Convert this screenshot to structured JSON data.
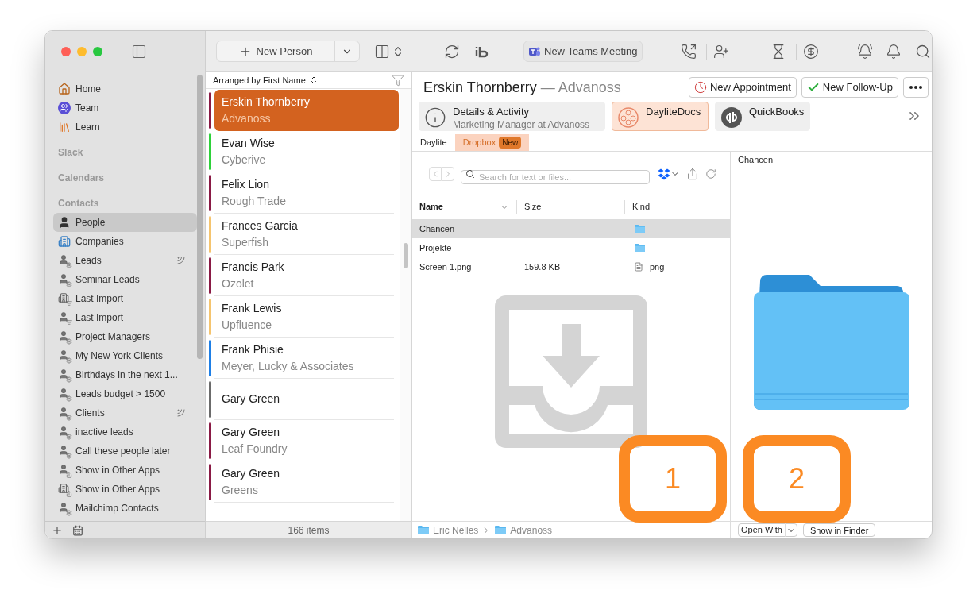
{
  "toolbar": {
    "new_person": "New Person",
    "teams_button": "New Teams Meeting"
  },
  "sidebar": {
    "top_items": [
      {
        "label": "Home",
        "kind": "home",
        "selected": false
      },
      {
        "label": "Team",
        "kind": "team",
        "selected": false
      },
      {
        "label": "Learn",
        "kind": "learn",
        "selected": false
      }
    ],
    "sections": [
      {
        "title": "Slack"
      },
      {
        "title": "Calendars"
      },
      {
        "title": "Contacts",
        "items": [
          {
            "label": "People",
            "kind": "person",
            "selected": true,
            "synced": false
          },
          {
            "label": "Companies",
            "kind": "company",
            "selected": false,
            "synced": false
          },
          {
            "label": "Leads",
            "kind": "smart",
            "selected": false,
            "synced": true
          },
          {
            "label": "Seminar Leads",
            "kind": "smart",
            "selected": false,
            "synced": false
          },
          {
            "label": "Last Import",
            "kind": "company-list",
            "selected": false,
            "synced": false
          },
          {
            "label": "Last Import",
            "kind": "person-list",
            "selected": false,
            "synced": false
          },
          {
            "label": "Project Managers",
            "kind": "smart",
            "selected": false,
            "synced": false
          },
          {
            "label": "My New York Clients",
            "kind": "smart",
            "selected": false,
            "synced": false
          },
          {
            "label": "Birthdays in the next 1...",
            "kind": "smart",
            "selected": false,
            "synced": false
          },
          {
            "label": "Leads budget > 1500",
            "kind": "smart",
            "selected": false,
            "synced": false
          },
          {
            "label": "Clients",
            "kind": "smart",
            "selected": false,
            "synced": true
          },
          {
            "label": "inactive leads",
            "kind": "smart",
            "selected": false,
            "synced": false
          },
          {
            "label": "Call these people later",
            "kind": "smart",
            "selected": false,
            "synced": false
          },
          {
            "label": "Show in Other Apps",
            "kind": "person-share",
            "selected": false,
            "synced": false
          },
          {
            "label": "Show in Other Apps",
            "kind": "company-share",
            "selected": false,
            "synced": false
          },
          {
            "label": "Mailchimp Contacts",
            "kind": "smart",
            "selected": false,
            "synced": false
          }
        ]
      }
    ]
  },
  "list": {
    "sort_label": "Arranged by First Name",
    "count": "166 items",
    "rows": [
      {
        "name": "Erskin Thornberry",
        "company": "Advanoss",
        "color": "#8a1a45",
        "selected": true
      },
      {
        "name": "Evan Wise",
        "company": "Cyberive",
        "color": "#2ed13a",
        "selected": false
      },
      {
        "name": "Felix Lion",
        "company": "Rough Trade",
        "color": "#8a1a45",
        "selected": false
      },
      {
        "name": "Frances Garcia",
        "company": "Superfish",
        "color": "#f5c46e",
        "selected": false
      },
      {
        "name": "Francis Park",
        "company": "Ozolet",
        "color": "#8a1a45",
        "selected": false
      },
      {
        "name": "Frank Lewis",
        "company": "Upfluence",
        "color": "#f5c46e",
        "selected": false
      },
      {
        "name": "Frank Phisie",
        "company": "Meyer, Lucky & Associates",
        "color": "#1e7fe6",
        "selected": false
      },
      {
        "name": "Gary Green",
        "color": "#6b6b6b",
        "selected": false
      },
      {
        "name": "Gary Green",
        "company": "Leaf Foundry",
        "color": "#8a1a45",
        "selected": false
      },
      {
        "name": "Gary Green",
        "company": "Greens",
        "color": "#8a1a45",
        "selected": false
      }
    ]
  },
  "detail": {
    "name": "Erskin Thornberry",
    "company": "— Advanoss",
    "buttons": [
      {
        "label": "New Appointment",
        "kind": "appointment"
      },
      {
        "label": "New Follow-Up",
        "kind": "followup"
      }
    ],
    "tabs": [
      {
        "title": "Details & Activity",
        "subtitle": "Marketing Manager at Advanoss",
        "kind": "info",
        "selected": false
      },
      {
        "title": "DayliteDocs",
        "kind": "docs",
        "selected": true
      },
      {
        "title": "QuickBooks",
        "kind": "qb",
        "selected": false
      }
    ],
    "subtabs": [
      {
        "label": "Daylite",
        "selected": false
      },
      {
        "label": "Dropbox",
        "badge": "New",
        "selected": true
      }
    ]
  },
  "file_browser": {
    "search_placeholder": "Search for text or files...",
    "columns": [
      "Name",
      "Size",
      "Kind"
    ],
    "rows": [
      {
        "name": "Chancen",
        "kind": "folder",
        "selected": true
      },
      {
        "name": "Projekte",
        "kind": "folder",
        "selected": false
      },
      {
        "name": "Screen 1.png",
        "size": "159.8 KB",
        "kind_label": "png",
        "kind": "file",
        "selected": false
      }
    ],
    "path": [
      "Eric Nelles",
      "Advanoss"
    ]
  },
  "preview": {
    "title": "Chancen",
    "open_with": "Open With",
    "show_button": "Show in Finder"
  },
  "callouts": [
    "1",
    "2"
  ]
}
